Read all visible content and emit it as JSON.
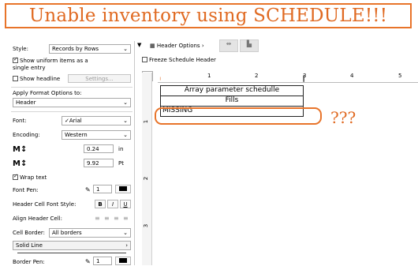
{
  "banner": {
    "title": "Unable inventory using SCHEDULE!!!"
  },
  "panel": {
    "style_label": "Style:",
    "style_value": "Records by Rows",
    "show_uniform_label": "Show uniform items as a single entry",
    "show_headline_label": "Show headline",
    "settings_label": "Settings...",
    "apply_format_label": "Apply Format Options to:",
    "apply_format_value": "Header",
    "font_label": "Font:",
    "font_value": "✓Arial",
    "encoding_label": "Encoding:",
    "encoding_value": "Western",
    "width_value": "0.24",
    "width_unit": "in",
    "height_value": "9.92",
    "height_unit": "Pt",
    "wrap_text_label": "Wrap text",
    "font_pen_label": "Font Pen:",
    "font_pen_value": "1",
    "header_cell_font_style_label": "Header Cell Font Style:",
    "bold_label": "B",
    "italic_label": "I",
    "underline_label": "U",
    "align_header_cell_label": "Align Header Cell:",
    "cell_border_label": "Cell Border:",
    "cell_border_value": "All borders",
    "line_type_value": "Solid Line",
    "border_pen_label": "Border Pen:",
    "border_pen_value": "1"
  },
  "toolbar": {
    "header_options_label": "Header Options",
    "freeze_header_label": "Freeze Schedule Header",
    "more_label": "..."
  },
  "ruler": {
    "ticks": [
      "1",
      "2",
      "3",
      "4",
      "5"
    ]
  },
  "vruler": {
    "ticks": [
      "1",
      "2",
      "3"
    ]
  },
  "schedule": {
    "title": "Array parameter schedulle",
    "column_header": "Fills",
    "cell_value": "MISSING"
  },
  "annotation": {
    "text": "???"
  },
  "colors": {
    "accent": "#e8742a"
  }
}
